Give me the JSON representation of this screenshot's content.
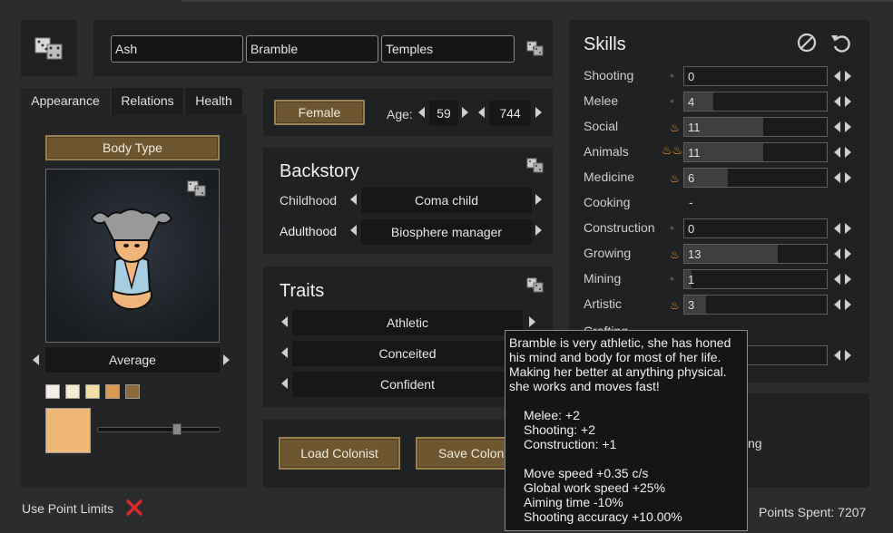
{
  "name": {
    "first": "Ash",
    "nick": "Bramble",
    "last": "Temples"
  },
  "tabs": [
    "Appearance",
    "Relations",
    "Health"
  ],
  "body_type_label": "Body Type",
  "head_type": "Average",
  "skin_swatches": [
    "#f4efe6",
    "#f6ead2",
    "#f3dea8",
    "#d99a4f",
    "#8e6a3a"
  ],
  "skin_color_preview": "#efb877",
  "gender_label": "Female",
  "age": {
    "label": "Age:",
    "bio": "59",
    "chrono": "744"
  },
  "backstory": {
    "title": "Backstory",
    "childhood_label": "Childhood",
    "childhood": "Coma child",
    "adulthood_label": "Adulthood",
    "adulthood": "Biosphere manager"
  },
  "traits": {
    "title": "Traits",
    "items": [
      "Athletic",
      "Conceited",
      "Confident"
    ]
  },
  "buttons": {
    "load": "Load Colonist",
    "save": "Save Colon"
  },
  "skills": {
    "title": "Skills",
    "rows": [
      {
        "name": "Shooting",
        "value": "0",
        "level": 0,
        "passion": "none"
      },
      {
        "name": "Melee",
        "value": "4",
        "level": 4,
        "passion": "none"
      },
      {
        "name": "Social",
        "value": "11",
        "level": 11,
        "passion": "minor"
      },
      {
        "name": "Animals",
        "value": "11",
        "level": 11,
        "passion": "major"
      },
      {
        "name": "Medicine",
        "value": "6",
        "level": 6,
        "passion": "minor"
      },
      {
        "name": "Cooking",
        "value": "-",
        "level": null,
        "passion": "disabled"
      },
      {
        "name": "Construction",
        "value": "0",
        "level": 0,
        "passion": "none"
      },
      {
        "name": "Growing",
        "value": "13",
        "level": 13,
        "passion": "minor"
      },
      {
        "name": "Mining",
        "value": "1",
        "level": 1,
        "passion": "none"
      },
      {
        "name": "Artistic",
        "value": "3",
        "level": 3,
        "passion": "minor"
      }
    ],
    "partial_label": "Crafting",
    "obscured_text": "ng"
  },
  "use_point_limits": "Use Point Limits",
  "points_spent": "Points Spent: 7207",
  "tooltip": {
    "intro": [
      "Bramble is very athletic, she has honed",
      "his mind and body for most of her life.",
      "Making her better at anything physical.",
      "she works and moves fast!"
    ],
    "stats": [
      "Melee:   +2",
      "Shooting:   +2",
      "Construction:   +1"
    ],
    "effects": [
      "Move speed +0.35 c/s",
      "Global work speed +25%",
      "Aiming time -10%",
      "Shooting accuracy +10.00%"
    ]
  },
  "colors": {
    "accent_brown": "#6d5630",
    "flame": "#f2a127",
    "panel": "#202123"
  },
  "icons": [
    "dice-icon",
    "no-symbol-icon",
    "reset-icon",
    "flame-icon",
    "close-x-icon",
    "arrow-left-icon",
    "arrow-right-icon"
  ]
}
